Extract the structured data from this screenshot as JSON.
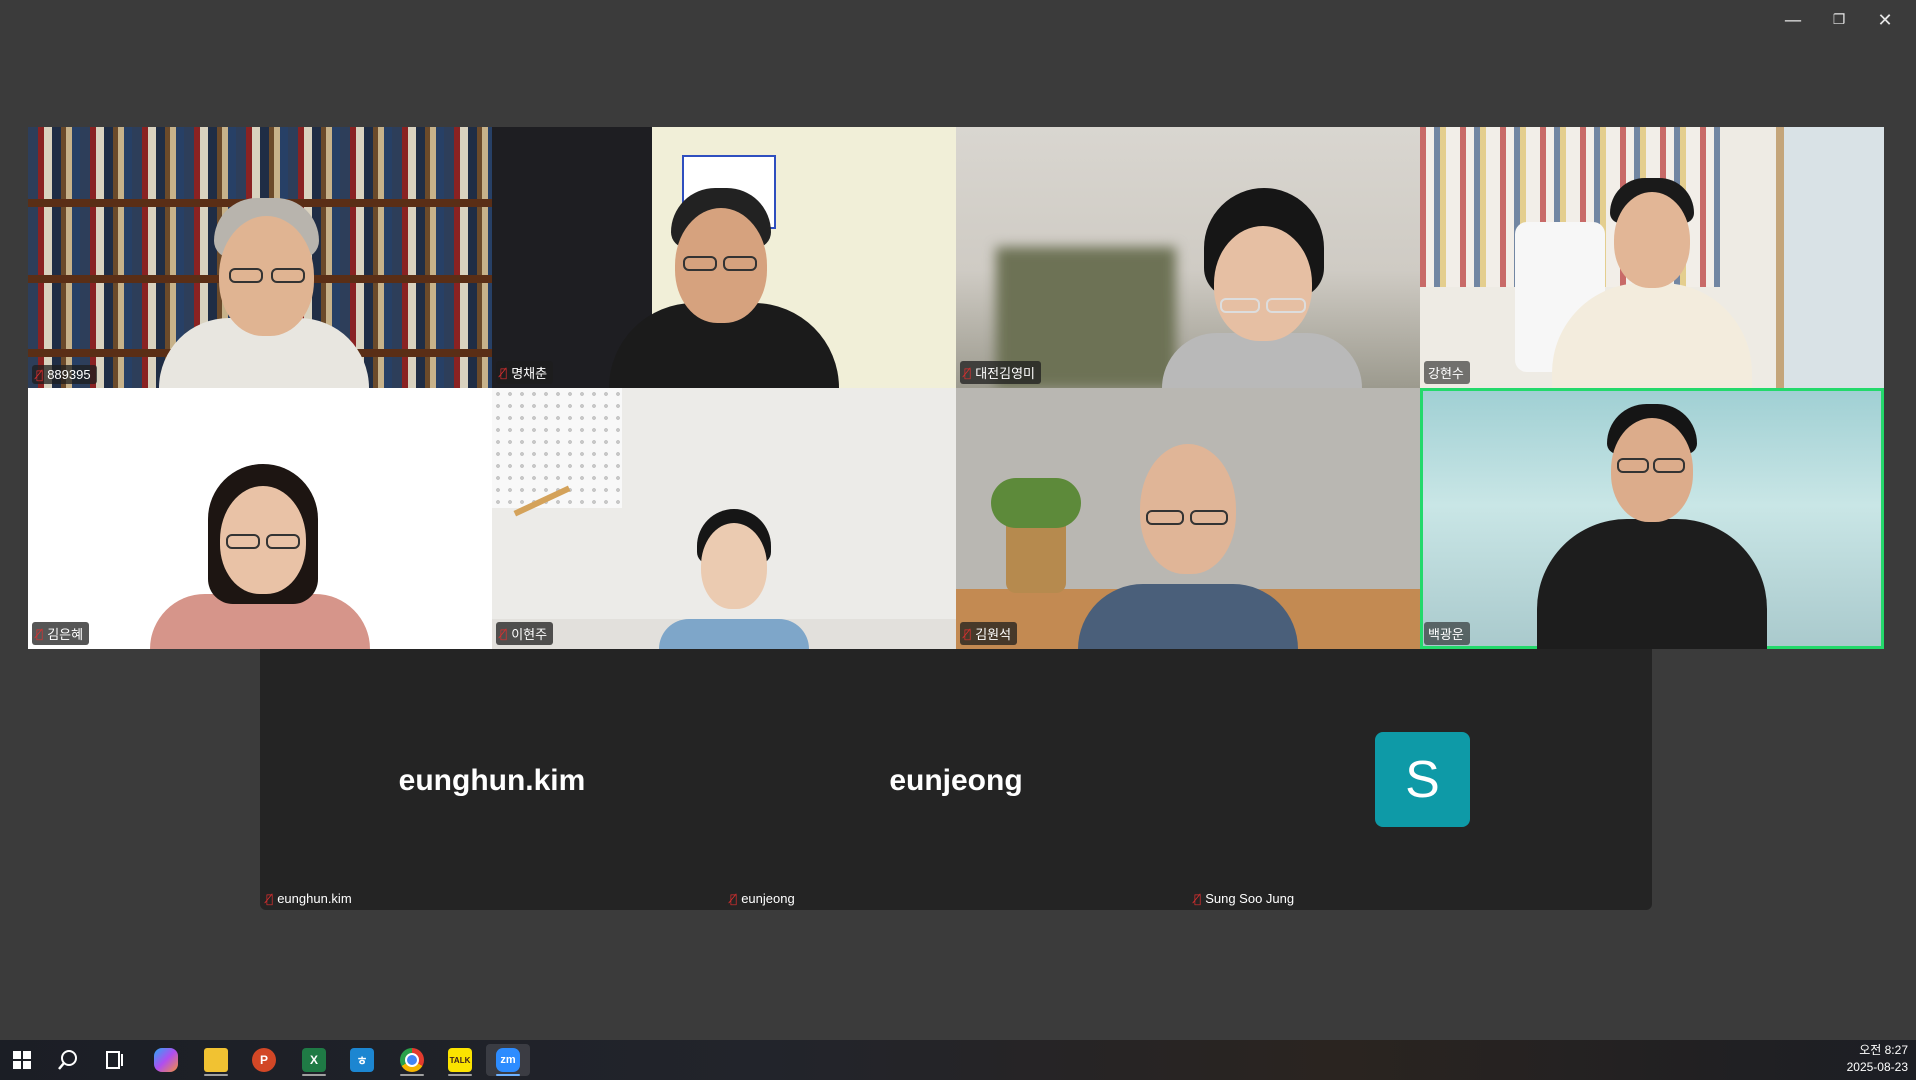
{
  "window_controls": {
    "minimize": "—",
    "restore": "❐",
    "close": "✕"
  },
  "participants_video": [
    {
      "name": "889395",
      "muted": true
    },
    {
      "name": "명채춘",
      "muted": true
    },
    {
      "name": "대전김영미",
      "muted": true
    },
    {
      "name": "강현수",
      "muted": false
    },
    {
      "name": "김은혜",
      "muted": true
    },
    {
      "name": "이현주",
      "muted": true
    },
    {
      "name": "김원석",
      "muted": true
    },
    {
      "name": "백광운",
      "muted": false,
      "speaking": true
    }
  ],
  "participants_no_video": [
    {
      "display": "eunghun.kim",
      "name": "eunghun.kim",
      "muted": true
    },
    {
      "display": "eunjeong",
      "name": "eunjeong",
      "muted": true
    },
    {
      "display": "S",
      "name": "Sung Soo Jung",
      "muted": true,
      "avatar_color": "#0e9aa7"
    }
  ],
  "mic_muted_icon": "🎤",
  "taskbar": {
    "icons": [
      "windows-start",
      "search",
      "task-view",
      "copilot",
      "file-explorer",
      "powerpoint",
      "excel",
      "hangul",
      "chrome",
      "kakaotalk",
      "zoom"
    ],
    "clock_time": "오전 8:27",
    "clock_date": "2025-08-23"
  }
}
